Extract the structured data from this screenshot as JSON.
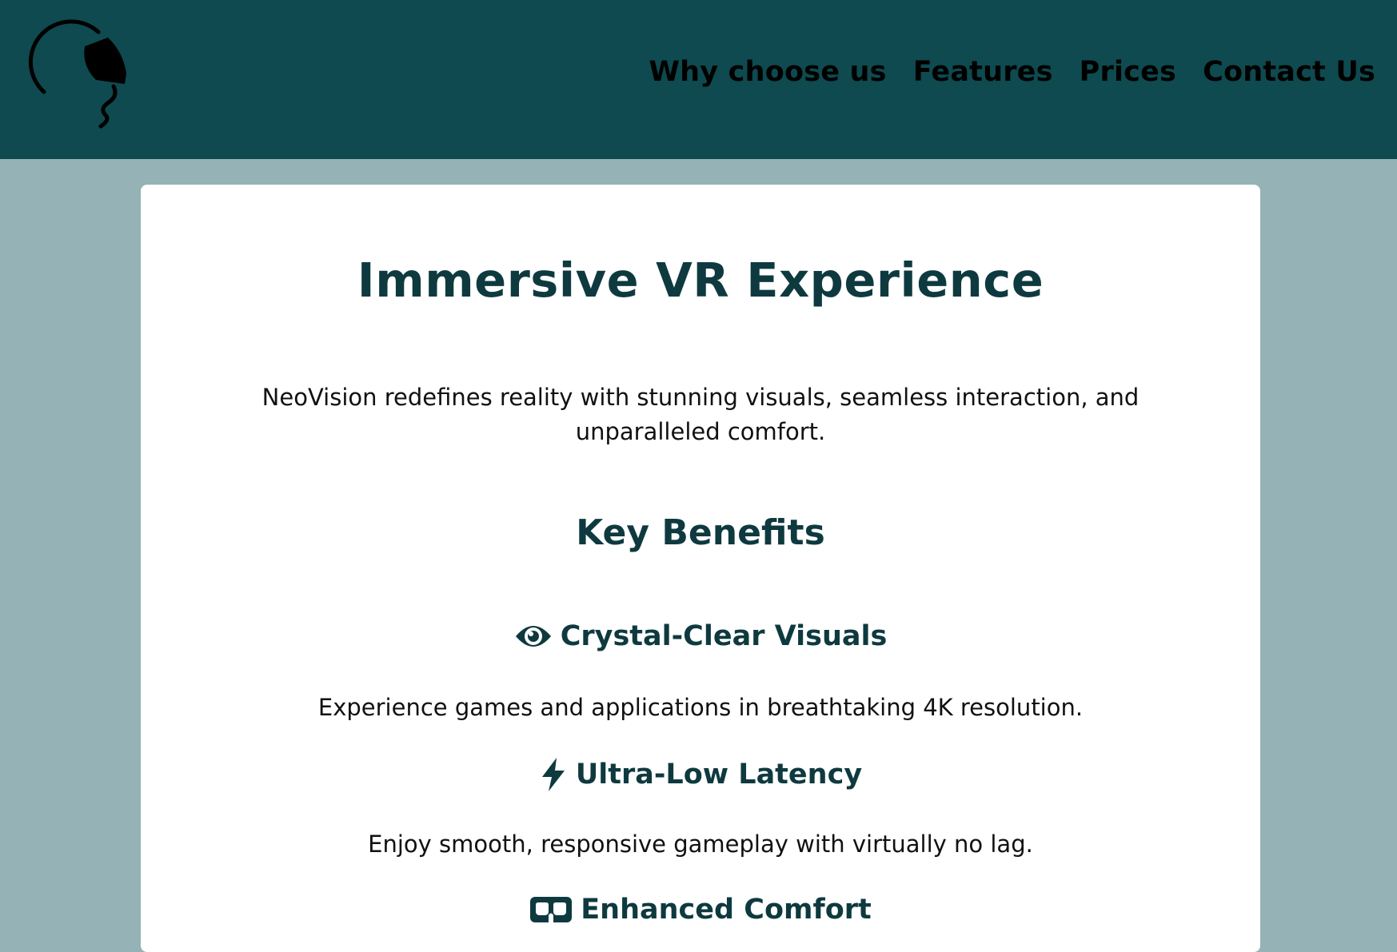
{
  "nav": {
    "items": [
      {
        "label": "Why choose us"
      },
      {
        "label": "Features"
      },
      {
        "label": "Prices"
      },
      {
        "label": "Contact Us"
      }
    ]
  },
  "hero": {
    "title": "Immersive VR Experience",
    "text": "NeoVision redefines reality with stunning visuals, seamless interaction, and unparalleled comfort."
  },
  "benefits": {
    "title": "Key Benefits",
    "items": [
      {
        "icon": "eye-icon",
        "title": "Crystal-Clear Visuals",
        "text": "Experience games and applications in breathtaking 4K resolution."
      },
      {
        "icon": "bolt-icon",
        "title": "Ultra-Low Latency",
        "text": "Enjoy smooth, responsive gameplay with virtually no lag."
      },
      {
        "icon": "vr-headset-icon",
        "title": "Enhanced Comfort",
        "text": ""
      }
    ]
  },
  "colors": {
    "header_bg": "#0e4a4f",
    "page_bg": "#95b3b6",
    "accent_text": "#0e3a3f"
  }
}
